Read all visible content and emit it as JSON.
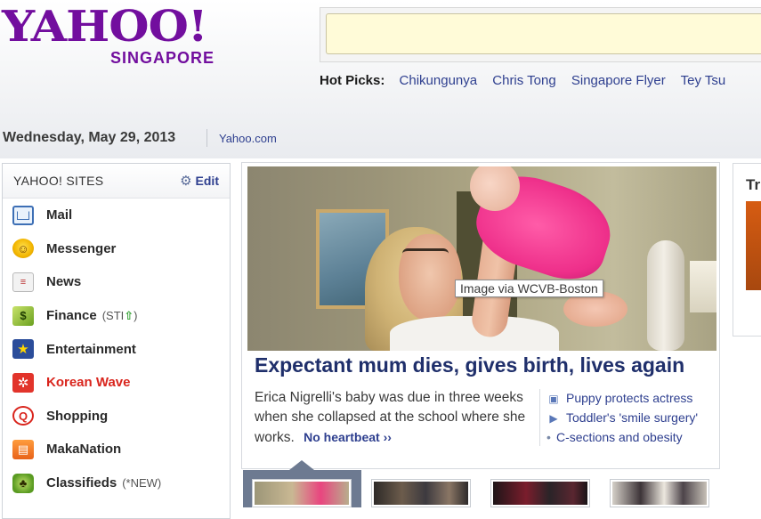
{
  "header": {
    "logo_text": "YAHOO!",
    "logo_region": "SINGAPORE",
    "search_placeholder": "",
    "hot_picks_label": "Hot Picks:",
    "hot_picks": [
      "Chikungunya",
      "Chris Tong",
      "Singapore Flyer",
      "Tey Tsu"
    ],
    "date": "Wednesday, May 29, 2013",
    "yahoo_link": "Yahoo.com"
  },
  "sidebar": {
    "title": "YAHOO! SITES",
    "edit_label": "Edit",
    "items": [
      {
        "label": "Mail",
        "icon": "mail-icon",
        "extra": ""
      },
      {
        "label": "Messenger",
        "icon": "messenger-icon",
        "extra": ""
      },
      {
        "label": "News",
        "icon": "news-icon",
        "extra": ""
      },
      {
        "label": "Finance",
        "icon": "finance-icon",
        "extra": "(STI"
      },
      {
        "label": "Entertainment",
        "icon": "entertainment-icon",
        "extra": ""
      },
      {
        "label": "Korean Wave",
        "icon": "korean-wave-icon",
        "extra": ""
      },
      {
        "label": "Shopping",
        "icon": "shopping-icon",
        "extra": ""
      },
      {
        "label": "MakaNation",
        "icon": "makanation-icon",
        "extra": ""
      },
      {
        "label": "Classifieds",
        "icon": "classifieds-icon",
        "extra": "(*NEW)"
      }
    ]
  },
  "story": {
    "image_tooltip": "Image via WCVB-Boston",
    "headline": "Expectant mum dies, gives birth, lives again",
    "summary": "Erica Nigrelli's baby was due in three weeks when she collapsed at the school where she works.",
    "more_link": "No heartbeat ››",
    "related": [
      {
        "label": "Puppy protects actress",
        "icon": "photo-icon"
      },
      {
        "label": "Toddler's 'smile surgery'",
        "icon": "video-icon"
      },
      {
        "label": "C-sections and obesity",
        "icon": "bullet"
      }
    ]
  },
  "right_panel": {
    "title_fragment": "Tr"
  },
  "colors": {
    "brand": "#720e9e",
    "link": "#2e3f8f",
    "headline": "#1f2f6b",
    "alert": "#d9251d",
    "search_bg": "#fffbd8"
  }
}
